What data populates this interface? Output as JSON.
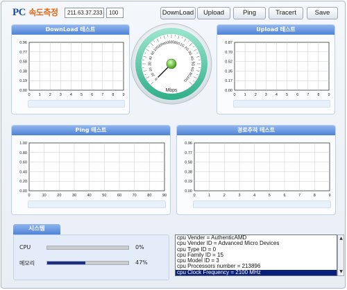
{
  "header": {
    "logo_pc": "PC",
    "logo_ko": "속도측정",
    "ip_value": "211.63.37.233",
    "count_value": "100",
    "buttons": {
      "download": "DownLoad",
      "upload": "Upload",
      "ping": "Ping",
      "tracert": "Tracert",
      "save": "Save"
    }
  },
  "gauge": {
    "unit": "Mbps",
    "labels": [
      "0",
      "10",
      "20",
      "30",
      "40",
      "60",
      "100",
      "200",
      "400",
      "600",
      "800",
      "1G",
      "2G",
      "3G",
      "4G",
      "5G",
      "6G",
      "8G",
      "10G"
    ],
    "needle_value": "0"
  },
  "chart_data": [
    {
      "type": "line",
      "title": "DownLoad 테스트",
      "x_ticks": [
        "0",
        "1",
        "2",
        "3",
        "4",
        "5",
        "6",
        "7",
        "8",
        "9"
      ],
      "y_ticks": [
        "0.96",
        "0.77",
        "0.58",
        "0.38",
        "0.19",
        "0.00"
      ],
      "series": []
    },
    {
      "type": "line",
      "title": "Upload 테스트",
      "x_ticks": [
        "0",
        "1",
        "2",
        "3",
        "4",
        "5",
        "6",
        "7",
        "8",
        "9"
      ],
      "y_ticks": [
        "0.87",
        "0.70",
        "0.52",
        "0.35",
        "0.17",
        "0.00"
      ],
      "series": []
    },
    {
      "type": "line",
      "title": "Ping 테스트",
      "x_ticks": [
        "0",
        "10",
        "20",
        "30",
        "40",
        "50",
        "60",
        "70",
        "80",
        "90"
      ],
      "y_ticks": [
        "1.00",
        "0.80",
        "0.60",
        "0.40",
        "0.20",
        "0.00"
      ],
      "series": []
    },
    {
      "type": "line",
      "title": "경로추적 테스트",
      "x_ticks": [
        "0",
        "1",
        "2",
        "3",
        "4",
        "5",
        "6",
        "7",
        "8",
        "9"
      ],
      "y_ticks": [
        "0.96",
        "0.77",
        "0.58",
        "0.38",
        "0.19",
        "0.00"
      ],
      "series": []
    }
  ],
  "system": {
    "tab": "시스템",
    "cpu_label": "CPU",
    "cpu_percent": "0%",
    "cpu_fraction": 0,
    "mem_label": "메모리",
    "mem_percent": "47%",
    "mem_fraction": 0.47
  },
  "log_lines": [
    "cpu Vender = AuthenticAMD",
    "cpu Vender ID = Advanced Micro Devices",
    "cpu Type ID = 0",
    "cpu Family ID = 15",
    "cpu Model ID = 3",
    "cpu Processors number = 213896",
    "cpu Clock Frequency = 2100 MHz"
  ],
  "log_selected_index": 6,
  "colors": {
    "accent": "#4f83d6",
    "gauge": "#3fbf9a",
    "mem_bar": "#1b2f8a",
    "logo_orange": "#e06a1a",
    "logo_blue": "#1d4f9c"
  }
}
